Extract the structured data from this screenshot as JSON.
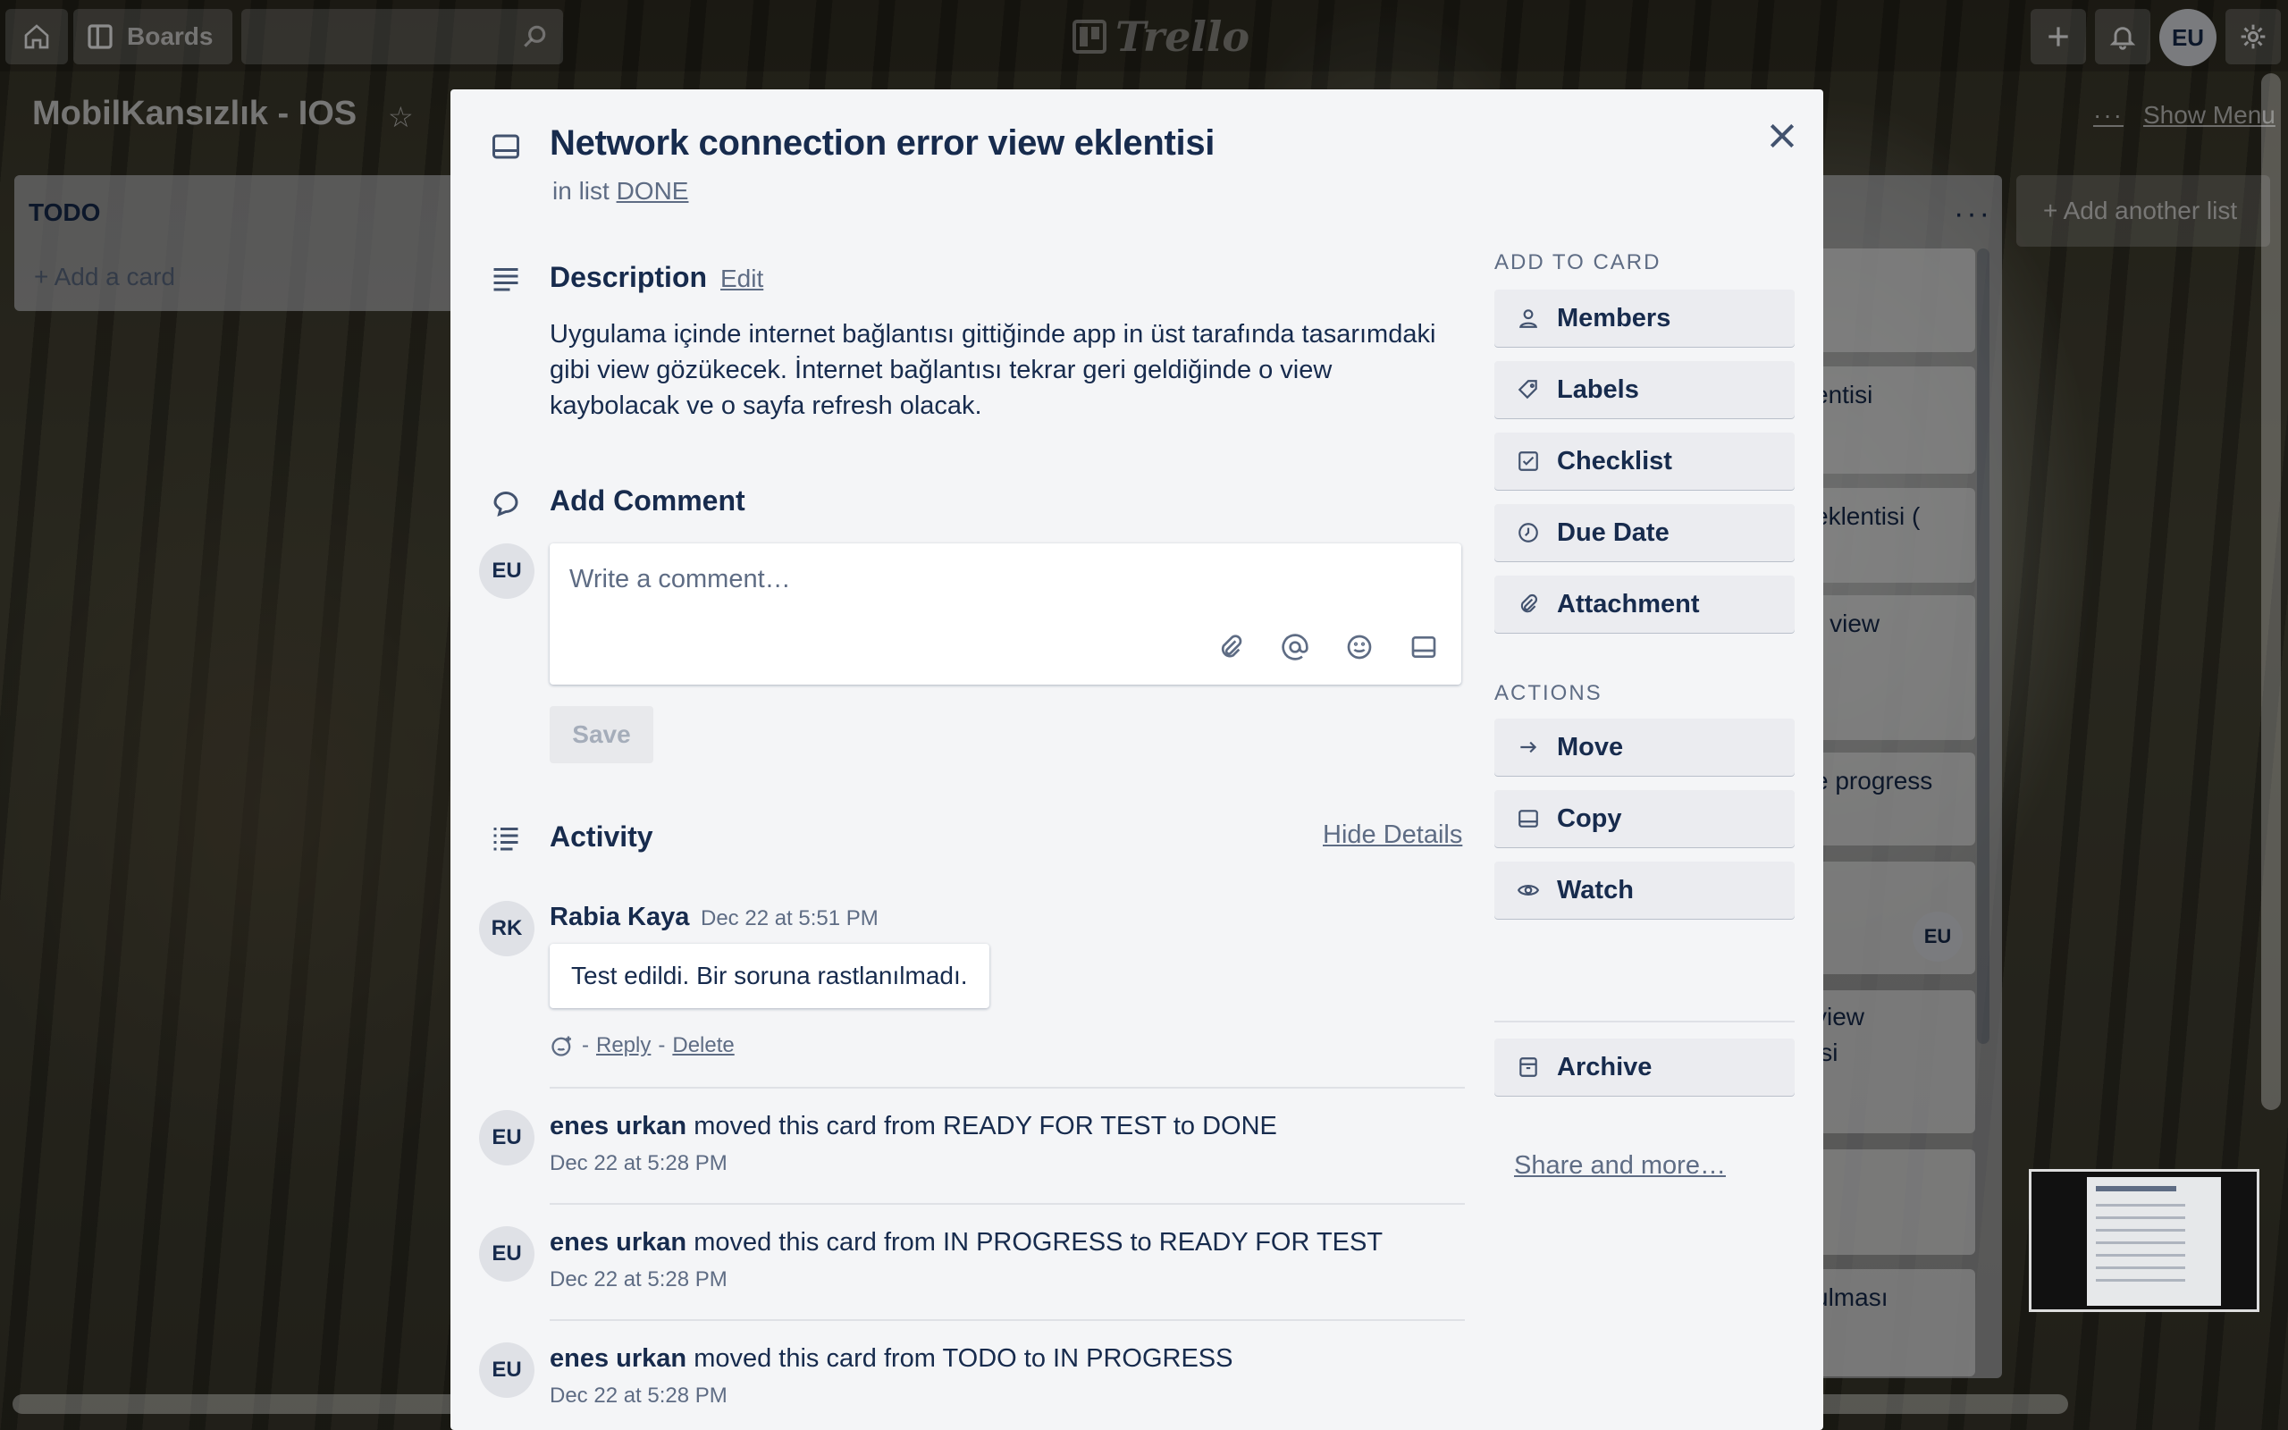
{
  "header": {
    "boards_label": "Boards",
    "logo_text": "Trello",
    "user_initials": "EU"
  },
  "board": {
    "title": "MobilKansızlık - IOS",
    "show_menu": "Show Menu",
    "add_list": "+ Add another list",
    "todo_list": {
      "title": "TODO",
      "add_card": "+ Add a card"
    },
    "done_card_fragments": [
      "entisi",
      "eklentisi (",
      "r view",
      "e progress",
      "view",
      "isi",
      "ulması"
    ],
    "done_card_member": "EU"
  },
  "card": {
    "title": "Network connection error view eklentisi",
    "in_list_prefix": "in list",
    "list_name": "DONE",
    "description_title": "Description",
    "edit_label": "Edit",
    "description": "Uygulama içinde internet bağlantısı gittiğinde app in üst tarafında tasarımdaki gibi view gözükecek. İnternet bağlantısı tekrar geri geldiğinde o view kaybolacak ve o sayfa refresh olacak.",
    "add_comment_title": "Add Comment",
    "commenter_initials": "EU",
    "comment_placeholder": "Write a comment…",
    "save_label": "Save",
    "activity_title": "Activity",
    "hide_details": "Hide Details",
    "comment": {
      "initials": "RK",
      "author": "Rabia Kaya",
      "time": "Dec 22 at 5:51 PM",
      "text": "Test edildi. Bir soruna rastlanılmadı.",
      "dash1": "-",
      "reply": "Reply",
      "dash2": "-",
      "delete": "Delete"
    },
    "activities": [
      {
        "initials": "EU",
        "author": "enes urkan",
        "text": "moved this card from READY FOR TEST to DONE",
        "time": "Dec 22 at 5:28 PM"
      },
      {
        "initials": "EU",
        "author": "enes urkan",
        "text": "moved this card from IN PROGRESS to READY FOR TEST",
        "time": "Dec 22 at 5:28 PM"
      },
      {
        "initials": "EU",
        "author": "enes urkan",
        "text": "moved this card from TODO to IN PROGRESS",
        "time": "Dec 22 at 5:28 PM"
      }
    ]
  },
  "sidebar": {
    "add_to_card_title": "ADD TO CARD",
    "add_to_card": [
      {
        "label": "Members",
        "icon": "person-icon"
      },
      {
        "label": "Labels",
        "icon": "label-icon"
      },
      {
        "label": "Checklist",
        "icon": "checklist-icon"
      },
      {
        "label": "Due Date",
        "icon": "clock-icon"
      },
      {
        "label": "Attachment",
        "icon": "paperclip-icon"
      }
    ],
    "actions_title": "ACTIONS",
    "actions": [
      {
        "label": "Move",
        "icon": "arrow-right-icon"
      },
      {
        "label": "Copy",
        "icon": "card-icon"
      },
      {
        "label": "Watch",
        "icon": "eye-icon"
      },
      {
        "label": "Archive",
        "icon": "archive-icon"
      }
    ],
    "share": "Share and more…"
  }
}
